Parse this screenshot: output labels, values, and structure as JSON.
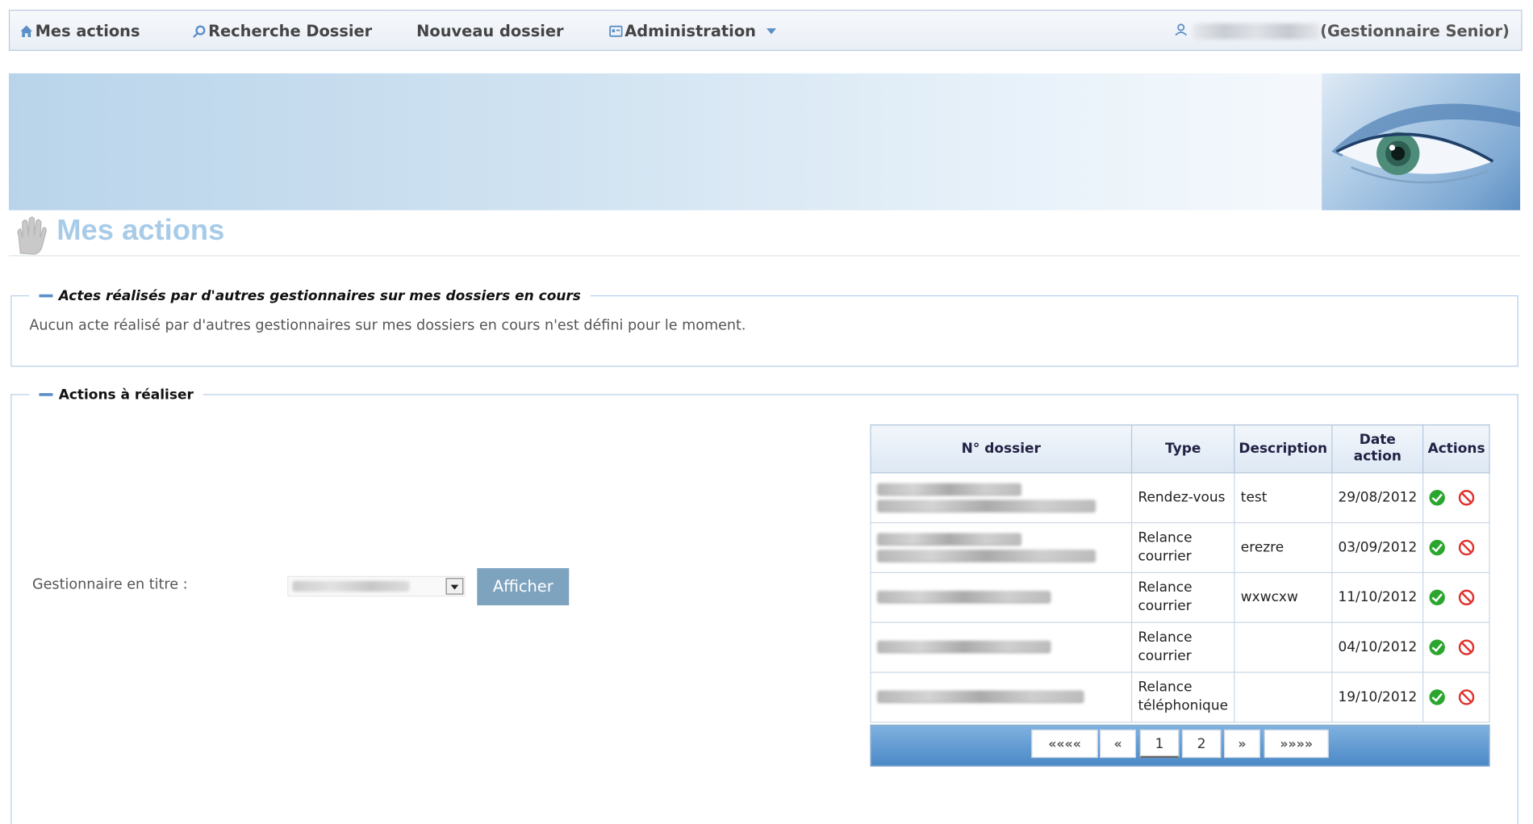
{
  "nav": {
    "items": [
      {
        "label": "Mes actions",
        "icon": "home-icon"
      },
      {
        "label": "Recherche Dossier",
        "icon": "search-icon"
      },
      {
        "label": "Nouveau dossier",
        "icon": ""
      },
      {
        "label": "Administration",
        "icon": "admin-icon"
      }
    ],
    "user_role": "(Gestionnaire Senior)"
  },
  "page": {
    "title": "Mes actions"
  },
  "section_autres": {
    "legend": "Actes réalisés par d'autres gestionnaires sur mes dossiers en cours",
    "empty_text": "Aucun acte réalisé par d'autres gestionnaires sur mes dossiers en cours n'est défini pour le moment."
  },
  "section_actions": {
    "legend": "Actions à réaliser",
    "filter_label": "Gestionnaire en titre :",
    "button_label": "Afficher"
  },
  "table": {
    "headers": {
      "ndossier": "N° dossier",
      "type": "Type",
      "description": "Description",
      "date_l1": "Date",
      "date_l2": "action",
      "actions": "Actions"
    },
    "rows": [
      {
        "type_l1": "Rendez-vous",
        "type_l2": "",
        "description": "test",
        "date": "29/08/2012"
      },
      {
        "type_l1": "Relance",
        "type_l2": "courrier",
        "description": "erezre",
        "date": "03/09/2012"
      },
      {
        "type_l1": "Relance",
        "type_l2": "courrier",
        "description": "wxwcxw",
        "date": "11/10/2012"
      },
      {
        "type_l1": "Relance",
        "type_l2": "courrier",
        "description": "",
        "date": "04/10/2012"
      },
      {
        "type_l1": "Relance",
        "type_l2": "téléphonique",
        "description": "",
        "date": "19/10/2012"
      }
    ]
  },
  "pager": {
    "first": "««««",
    "prev": "«",
    "page1": "1",
    "page2": "2",
    "next": "»",
    "last": "»»»»"
  },
  "colors": {
    "accent": "#4b89c7",
    "button": "#7ea3bf",
    "title": "#a8cbe8",
    "ok": "#2aa52d",
    "cancel": "#e0302d"
  }
}
